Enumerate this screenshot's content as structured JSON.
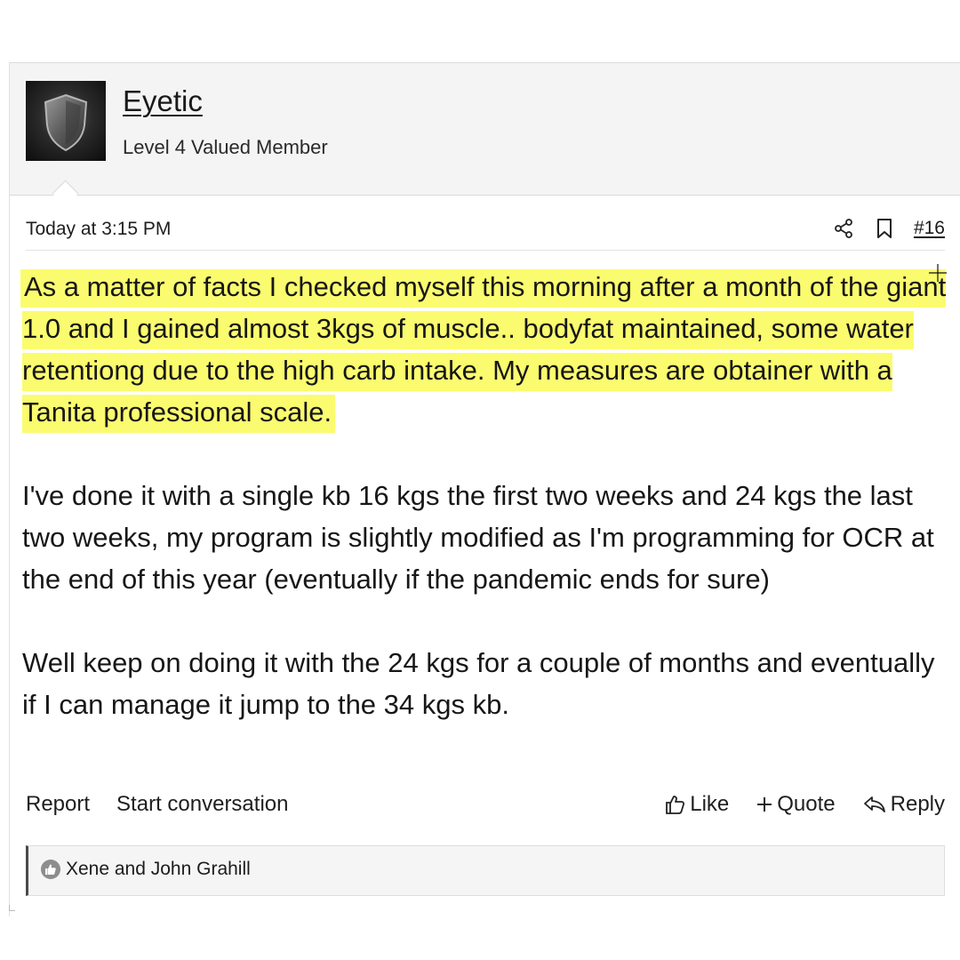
{
  "user": {
    "name": "Eyetic",
    "title": "Level 4 Valued Member",
    "avatar_icon": "shield-icon"
  },
  "meta": {
    "timestamp": "Today at 3:15 PM",
    "post_number": "#16",
    "share_icon": "share-icon",
    "bookmark_icon": "bookmark-icon"
  },
  "content": {
    "highlighted_paragraph": "As a matter of facts I checked myself this morning after a month of the giant 1.0 and I gained almost 3kgs of muscle.. bodyfat maintained, some water retentiong due to the high carb intake. My measures are obtainer with a Tanita professional scale.",
    "paragraph_2": "I've done it with a single kb 16 kgs the first two weeks and 24 kgs the last two weeks, my program is slightly modified as I'm programming for OCR at the end of this year (eventually if the pandemic ends for sure)",
    "paragraph_3": "Well keep on doing it with the 24 kgs for a couple of months and eventually if I can manage it jump to the 34 kgs kb.",
    "highlight_color": "#fbfb6f"
  },
  "footer": {
    "report_label": "Report",
    "start_conversation_label": "Start conversation",
    "like_label": "Like",
    "quote_label": "Quote",
    "reply_label": "Reply"
  },
  "reactions": {
    "text": "Xene and John Grahill"
  }
}
